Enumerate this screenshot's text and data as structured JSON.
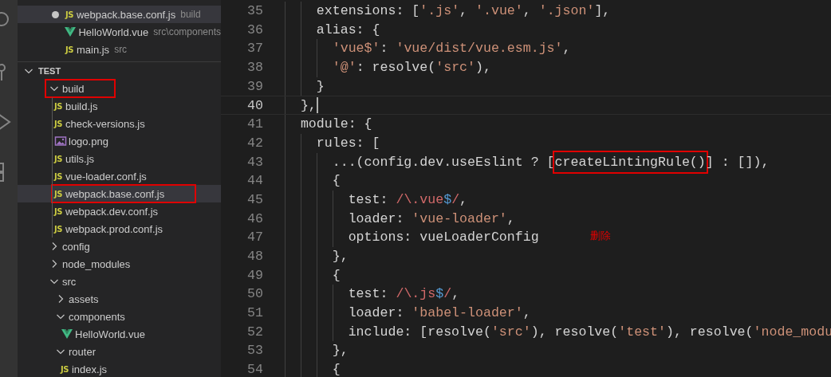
{
  "open_editors": [
    {
      "name": "webpack.base.conf.js",
      "description": "build",
      "kind": "js",
      "icon_label": "JS",
      "modified": true,
      "selected": true
    },
    {
      "name": "HelloWorld.vue",
      "description": "src\\components",
      "kind": "vue",
      "modified": false,
      "selected": false
    },
    {
      "name": "main.js",
      "description": "src",
      "kind": "js",
      "icon_label": "JS",
      "modified": false,
      "selected": false
    }
  ],
  "explorer": {
    "title": "TEST",
    "expanded": true,
    "tree": [
      {
        "name": "build",
        "kind": "folder",
        "expanded": true,
        "boxed": true,
        "selected": false,
        "children": [
          {
            "name": "build.js",
            "kind": "js",
            "icon_label": "JS",
            "boxed": false,
            "selected": false
          },
          {
            "name": "check-versions.js",
            "kind": "js",
            "icon_label": "JS",
            "boxed": false,
            "selected": false
          },
          {
            "name": "logo.png",
            "kind": "image",
            "boxed": false,
            "selected": false
          },
          {
            "name": "utils.js",
            "kind": "js",
            "icon_label": "JS",
            "boxed": false,
            "selected": false
          },
          {
            "name": "vue-loader.conf.js",
            "kind": "js",
            "icon_label": "JS",
            "boxed": false,
            "selected": false
          },
          {
            "name": "webpack.base.conf.js",
            "kind": "js",
            "icon_label": "JS",
            "boxed": true,
            "selected": true
          },
          {
            "name": "webpack.dev.conf.js",
            "kind": "js",
            "icon_label": "JS",
            "boxed": false,
            "selected": false
          },
          {
            "name": "webpack.prod.conf.js",
            "kind": "js",
            "icon_label": "JS",
            "boxed": false,
            "selected": false
          }
        ]
      },
      {
        "name": "config",
        "kind": "folder",
        "expanded": false,
        "boxed": false,
        "selected": false
      },
      {
        "name": "node_modules",
        "kind": "folder",
        "expanded": false,
        "boxed": false,
        "selected": false
      },
      {
        "name": "src",
        "kind": "folder",
        "expanded": true,
        "boxed": false,
        "selected": false,
        "children": [
          {
            "name": "assets",
            "kind": "folder",
            "expanded": false,
            "boxed": false,
            "selected": false
          },
          {
            "name": "components",
            "kind": "folder",
            "expanded": true,
            "boxed": false,
            "selected": false,
            "children": [
              {
                "name": "HelloWorld.vue",
                "kind": "vue",
                "boxed": false,
                "selected": false
              }
            ]
          },
          {
            "name": "router",
            "kind": "folder",
            "expanded": true,
            "boxed": false,
            "selected": false,
            "children": [
              {
                "name": "index.js",
                "kind": "js",
                "icon_label": "JS",
                "boxed": false,
                "selected": false
              }
            ]
          }
        ]
      }
    ]
  },
  "editor": {
    "lines": [
      {
        "number": "35",
        "current": false,
        "cursor": false,
        "tokens": [
          {
            "kind": "plain",
            "text": "    extensions: ["
          },
          {
            "kind": "string",
            "text": "'.js'"
          },
          {
            "kind": "plain",
            "text": ", "
          },
          {
            "kind": "string",
            "text": "'.vue'"
          },
          {
            "kind": "plain",
            "text": ", "
          },
          {
            "kind": "string",
            "text": "'.json'"
          },
          {
            "kind": "plain",
            "text": "],"
          }
        ]
      },
      {
        "number": "36",
        "current": false,
        "cursor": false,
        "tokens": [
          {
            "kind": "plain",
            "text": "    alias: {"
          }
        ]
      },
      {
        "number": "37",
        "current": false,
        "cursor": false,
        "tokens": [
          {
            "kind": "string",
            "text": "      'vue$'"
          },
          {
            "kind": "plain",
            "text": ": "
          },
          {
            "kind": "string",
            "text": "'vue/dist/vue.esm.js'"
          },
          {
            "kind": "plain",
            "text": ","
          }
        ]
      },
      {
        "number": "38",
        "current": false,
        "cursor": false,
        "tokens": [
          {
            "kind": "string",
            "text": "      '@'"
          },
          {
            "kind": "plain",
            "text": ": resolve("
          },
          {
            "kind": "string",
            "text": "'src'"
          },
          {
            "kind": "plain",
            "text": "),"
          }
        ]
      },
      {
        "number": "39",
        "current": false,
        "cursor": false,
        "tokens": [
          {
            "kind": "plain",
            "text": "    }"
          }
        ]
      },
      {
        "number": "40",
        "current": true,
        "cursor": true,
        "tokens": [
          {
            "kind": "plain",
            "text": "  },"
          }
        ]
      },
      {
        "number": "41",
        "current": false,
        "cursor": false,
        "tokens": [
          {
            "kind": "plain",
            "text": "  module: {"
          }
        ]
      },
      {
        "number": "42",
        "current": false,
        "cursor": false,
        "tokens": [
          {
            "kind": "plain",
            "text": "    rules: ["
          }
        ]
      },
      {
        "number": "43",
        "current": false,
        "cursor": false,
        "tokens": [
          {
            "kind": "plain",
            "text": "      ...(config.dev.useEslint ? ["
          },
          {
            "kind": "plain",
            "text": "createLintingRule()",
            "boxed": true
          },
          {
            "kind": "plain",
            "text": "] : []),"
          }
        ]
      },
      {
        "number": "44",
        "current": false,
        "cursor": false,
        "tokens": [
          {
            "kind": "plain",
            "text": "      {"
          }
        ]
      },
      {
        "number": "45",
        "current": false,
        "cursor": false,
        "tokens": [
          {
            "kind": "plain",
            "text": "        test: "
          },
          {
            "kind": "regex",
            "text": "/\\.vue"
          },
          {
            "kind": "anchor",
            "text": "$"
          },
          {
            "kind": "regex",
            "text": "/"
          },
          {
            "kind": "plain",
            "text": ","
          }
        ]
      },
      {
        "number": "46",
        "current": false,
        "cursor": false,
        "tokens": [
          {
            "kind": "plain",
            "text": "        loader: "
          },
          {
            "kind": "string",
            "text": "'vue-loader'"
          },
          {
            "kind": "plain",
            "text": ","
          }
        ]
      },
      {
        "number": "47",
        "current": false,
        "cursor": false,
        "tokens": [
          {
            "kind": "plain",
            "text": "        options: vueLoaderConfig"
          }
        ]
      },
      {
        "number": "48",
        "current": false,
        "cursor": false,
        "tokens": [
          {
            "kind": "plain",
            "text": "      },"
          }
        ]
      },
      {
        "number": "49",
        "current": false,
        "cursor": false,
        "tokens": [
          {
            "kind": "plain",
            "text": "      {"
          }
        ]
      },
      {
        "number": "50",
        "current": false,
        "cursor": false,
        "tokens": [
          {
            "kind": "plain",
            "text": "        test: "
          },
          {
            "kind": "regex",
            "text": "/\\.js"
          },
          {
            "kind": "anchor",
            "text": "$"
          },
          {
            "kind": "regex",
            "text": "/"
          },
          {
            "kind": "plain",
            "text": ","
          }
        ]
      },
      {
        "number": "51",
        "current": false,
        "cursor": false,
        "tokens": [
          {
            "kind": "plain",
            "text": "        loader: "
          },
          {
            "kind": "string",
            "text": "'babel-loader'"
          },
          {
            "kind": "plain",
            "text": ","
          }
        ]
      },
      {
        "number": "52",
        "current": false,
        "cursor": false,
        "tokens": [
          {
            "kind": "plain",
            "text": "        include: [resolve("
          },
          {
            "kind": "string",
            "text": "'src'"
          },
          {
            "kind": "plain",
            "text": "), resolve("
          },
          {
            "kind": "string",
            "text": "'test'"
          },
          {
            "kind": "plain",
            "text": "), resolve("
          },
          {
            "kind": "string",
            "text": "'node_modu"
          }
        ]
      },
      {
        "number": "53",
        "current": false,
        "cursor": false,
        "tokens": [
          {
            "kind": "plain",
            "text": "      },"
          }
        ]
      },
      {
        "number": "54",
        "current": false,
        "cursor": false,
        "tokens": [
          {
            "kind": "plain",
            "text": "      {"
          }
        ]
      }
    ],
    "annotation": {
      "text": "删除"
    }
  }
}
